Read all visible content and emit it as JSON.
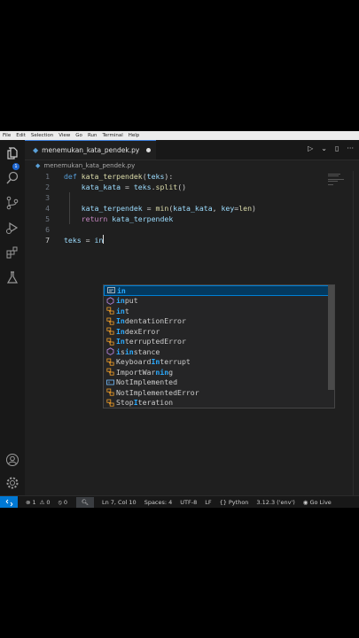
{
  "menu": [
    "File",
    "Edit",
    "Selection",
    "View",
    "Go",
    "Run",
    "Terminal",
    "Help"
  ],
  "activity_bar": {
    "explorer_badge": "1"
  },
  "tab": {
    "filename": "menemukan_kata_pendek.py",
    "modified": true
  },
  "breadcrumb": {
    "file": "menemukan_kata_pendek.py"
  },
  "editor": {
    "line_numbers": [
      "1",
      "2",
      "3",
      "4",
      "5",
      "6",
      "7"
    ],
    "lines": [
      [
        {
          "t": "def ",
          "c": "kw-def"
        },
        {
          "t": "kata_terpendek",
          "c": "fn"
        },
        {
          "t": "(",
          "c": ""
        },
        {
          "t": "teks",
          "c": "var"
        },
        {
          "t": "):",
          "c": ""
        }
      ],
      [
        {
          "t": "    kata_kata ",
          "c": "var"
        },
        {
          "t": "= ",
          "c": ""
        },
        {
          "t": "teks",
          "c": "var"
        },
        {
          "t": ".",
          "c": ""
        },
        {
          "t": "split",
          "c": "fn"
        },
        {
          "t": "()",
          "c": ""
        }
      ],
      [],
      [
        {
          "t": "    kata_terpendek ",
          "c": "var"
        },
        {
          "t": "= ",
          "c": ""
        },
        {
          "t": "min",
          "c": "fn"
        },
        {
          "t": "(",
          "c": ""
        },
        {
          "t": "kata_kata",
          "c": "var"
        },
        {
          "t": ", ",
          "c": ""
        },
        {
          "t": "key",
          "c": "var"
        },
        {
          "t": "=",
          "c": ""
        },
        {
          "t": "len",
          "c": "fn"
        },
        {
          "t": ")",
          "c": ""
        }
      ],
      [
        {
          "t": "    return ",
          "c": "kw-ret"
        },
        {
          "t": "kata_terpendek",
          "c": "var"
        }
      ],
      [],
      [
        {
          "t": "teks ",
          "c": "var"
        },
        {
          "t": "= ",
          "c": ""
        },
        {
          "t": "in",
          "c": "var"
        }
      ]
    ]
  },
  "suggestions": [
    {
      "pre": "",
      "match": "in",
      "post": "",
      "kind": "keyword"
    },
    {
      "pre": "",
      "match": "in",
      "post": "put",
      "kind": "function"
    },
    {
      "pre": "",
      "match": "in",
      "post": "t",
      "kind": "class"
    },
    {
      "pre": "",
      "match": "In",
      "post": "dentationError",
      "kind": "class"
    },
    {
      "pre": "",
      "match": "In",
      "post": "dexError",
      "kind": "class"
    },
    {
      "pre": "",
      "match": "In",
      "post": "terruptedError",
      "kind": "class"
    },
    {
      "pre": "",
      "match": "i",
      "post": "s",
      "match2": "in",
      "post2": "stance",
      "kind": "function"
    },
    {
      "pre": "Keyboard",
      "match": "In",
      "post": "terrupt",
      "kind": "class"
    },
    {
      "pre": "ImportWar",
      "match": "n",
      "post": "",
      "match2": "in",
      "post2": "g",
      "kind": "class"
    },
    {
      "pre": "NotImplemented",
      "match": "",
      "post": "",
      "kind": "variable"
    },
    {
      "pre": "NotImplemente",
      "match": "",
      "post": "dError",
      "kind": "class"
    },
    {
      "pre": "Stop",
      "match": "I",
      "post": "teration",
      "kind": "class"
    }
  ],
  "status": {
    "errors": "1",
    "warnings": "0",
    "ports": "0",
    "position": "Ln 7, Col 10",
    "spaces": "Spaces: 4",
    "encoding": "UTF-8",
    "eol": "LF",
    "language": "Python",
    "interpreter": "3.12.3 ('env')",
    "golive": "Go Live"
  },
  "colors": {
    "accent": "#0078d4",
    "selection": "#04395e",
    "match": "#2aaaff"
  }
}
